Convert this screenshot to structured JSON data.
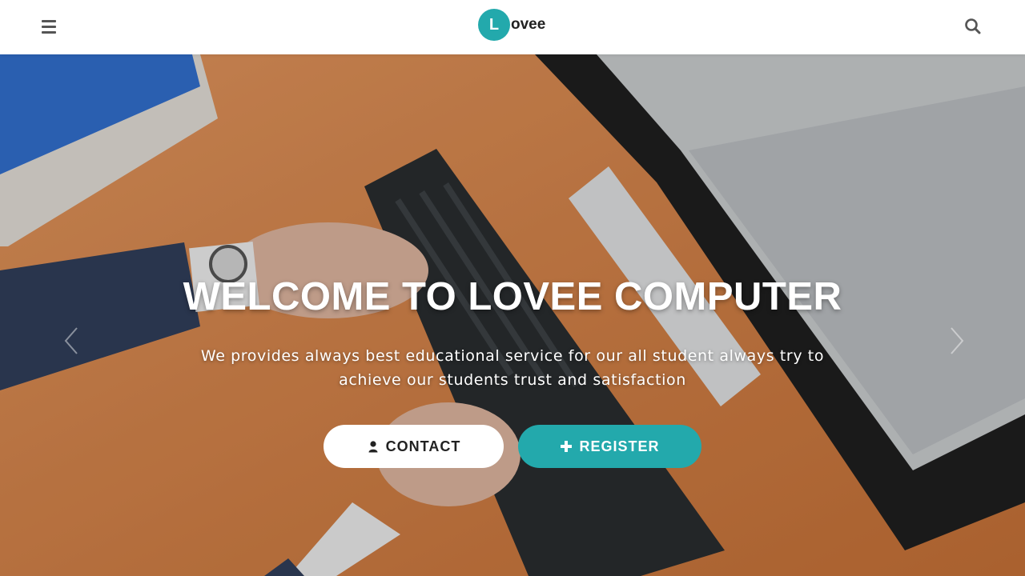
{
  "header": {
    "logo_letter": "L",
    "logo_text": "ovee",
    "menu_icon": "hamburger-menu-icon",
    "search_icon": "search-icon"
  },
  "hero": {
    "title": "WELCOME TO LOVEE COMPUTER",
    "subtitle_line1": "We provides always best educational service for our all student always try to",
    "subtitle_line2": "achieve our students trust and satisfaction",
    "contact_label": "CONTACT",
    "register_label": "REGISTER",
    "contact_icon": "user-icon",
    "register_icon": "plus-icon",
    "prev_icon": "chevron-left-icon",
    "next_icon": "chevron-right-icon"
  },
  "colors": {
    "accent": "#23a9ac",
    "header_bg": "#ffffff",
    "button_light": "#ffffff"
  }
}
